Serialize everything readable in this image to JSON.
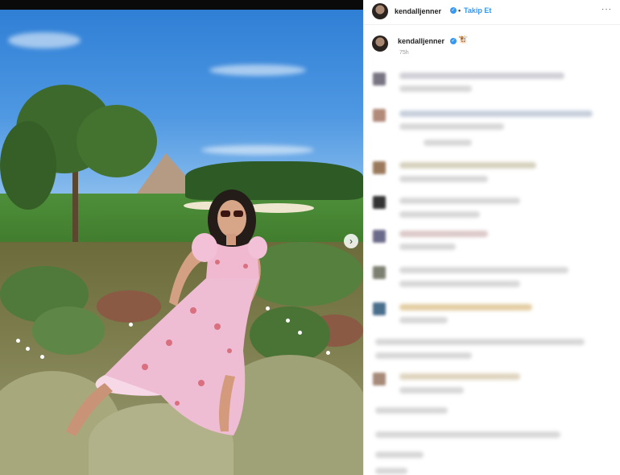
{
  "post": {
    "username": "kendalljenner",
    "follow_label": "Takip Et",
    "follow_separator": "•",
    "more_icon": "more-dots-icon",
    "caption_username": "kendalljenner",
    "caption_emoji": "🐮",
    "time_ago": "75h",
    "next_photo_icon": "›"
  },
  "colors": {
    "accent": "#3897f0",
    "text": "#262626"
  }
}
